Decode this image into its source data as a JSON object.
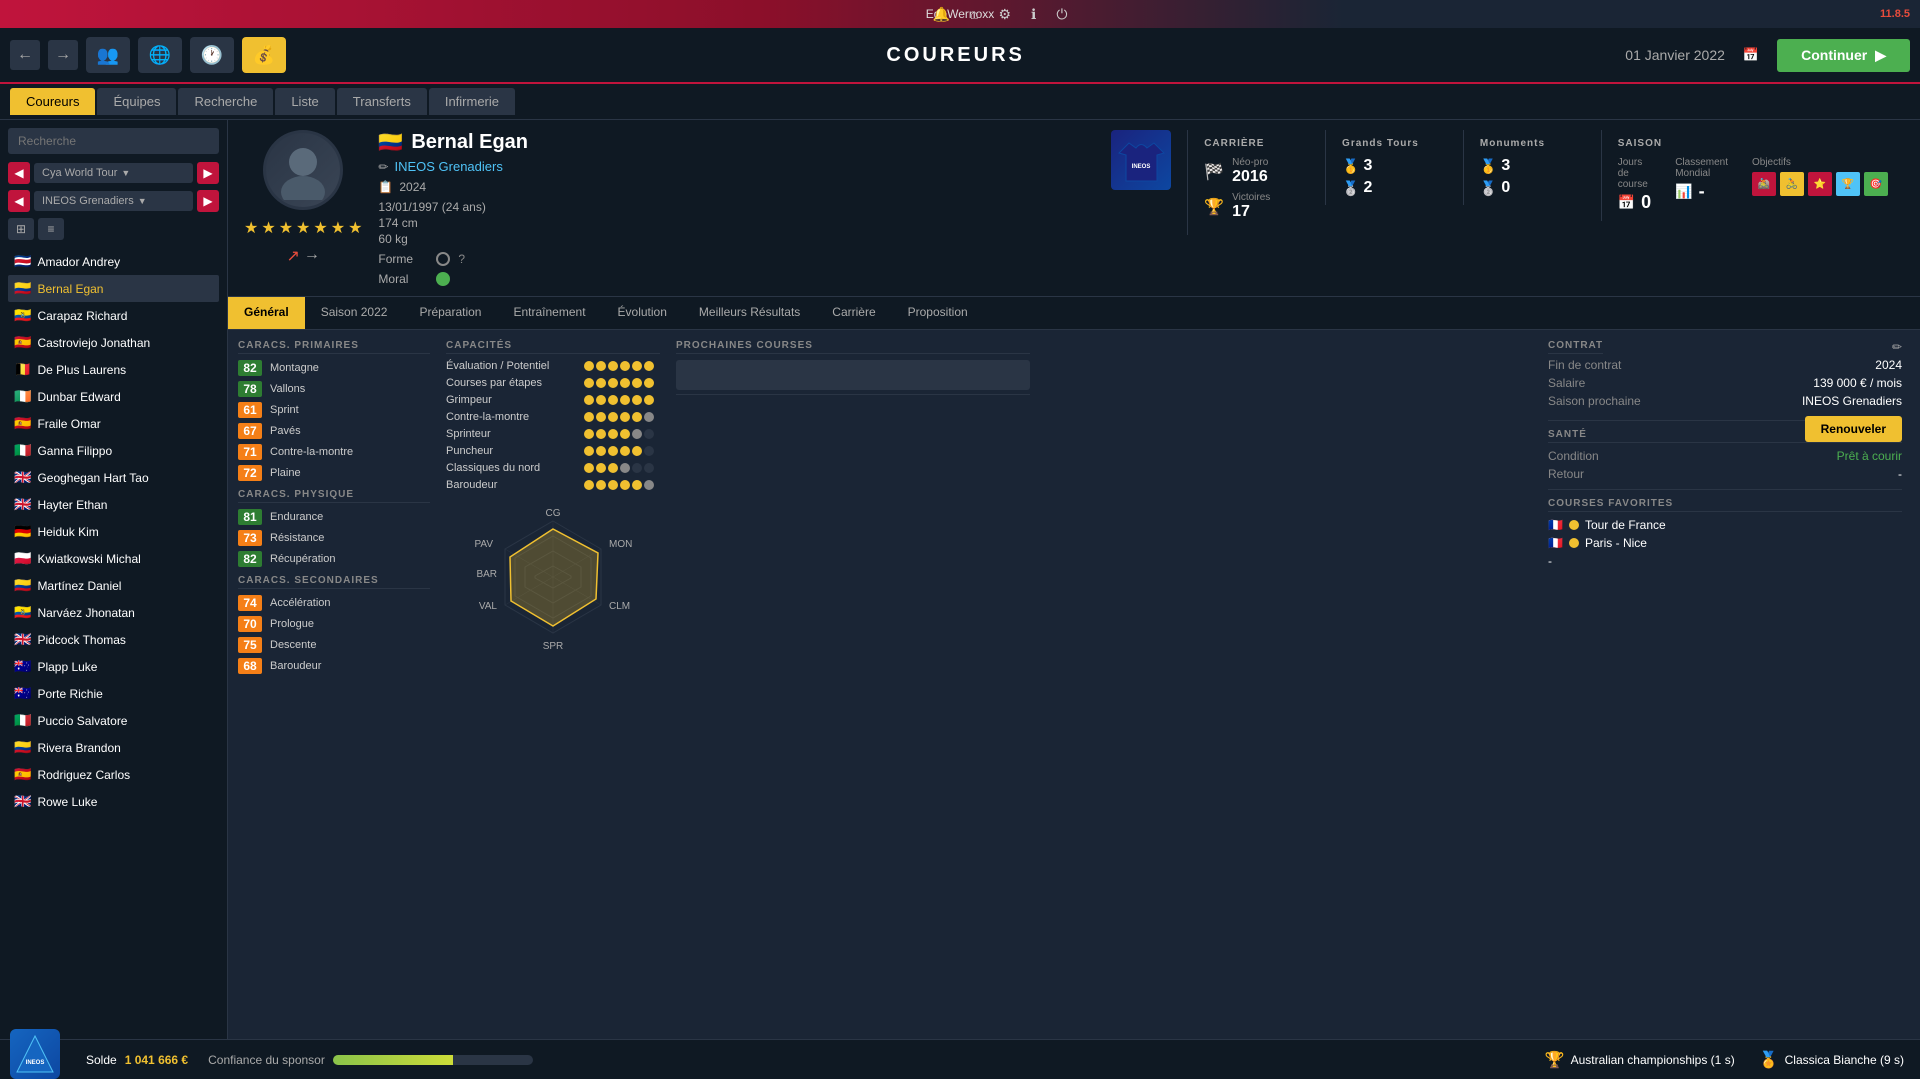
{
  "app": {
    "title": "EgoWernoxx",
    "page_title": "COUREURS",
    "date": "01 Janvier 2022",
    "continue_label": "Continuer",
    "version": "11.8.5"
  },
  "nav_icons": [
    "bell",
    "home",
    "gear",
    "info",
    "power"
  ],
  "nav_tabs": [
    "Coureurs",
    "Équipes",
    "Recherche",
    "Liste",
    "Transferts",
    "Infirmerie"
  ],
  "sidebar": {
    "search_placeholder": "Recherche",
    "filter1": "Cya World Tour",
    "filter2": "INEOS Grenadiers",
    "riders": [
      {
        "name": "Amador Andrey",
        "flag": "🇨🇷"
      },
      {
        "name": "Bernal Egan",
        "flag": "🇨🇴",
        "active": true
      },
      {
        "name": "Carapaz Richard",
        "flag": "🇪🇨"
      },
      {
        "name": "Castroviejo Jonathan",
        "flag": "🇪🇸"
      },
      {
        "name": "De Plus Laurens",
        "flag": "🇧🇪"
      },
      {
        "name": "Dunbar Edward",
        "flag": "🇮🇪"
      },
      {
        "name": "Fraile Omar",
        "flag": "🇪🇸"
      },
      {
        "name": "Ganna Filippo",
        "flag": "🇮🇹"
      },
      {
        "name": "Geoghegan Hart Tao",
        "flag": "🇬🇧"
      },
      {
        "name": "Hayter Ethan",
        "flag": "🇬🇧"
      },
      {
        "name": "Heiduk Kim",
        "flag": "🇩🇪"
      },
      {
        "name": "Kwiatkowski Michal",
        "flag": "🇵🇱"
      },
      {
        "name": "Martínez Daniel",
        "flag": "🇨🇴"
      },
      {
        "name": "Narváez Jhonatan",
        "flag": "🇪🇨"
      },
      {
        "name": "Pidcock Thomas",
        "flag": "🇬🇧"
      },
      {
        "name": "Plapp Luke",
        "flag": "🇦🇺"
      },
      {
        "name": "Porte Richie",
        "flag": "🇦🇺"
      },
      {
        "name": "Puccio Salvatore",
        "flag": "🇮🇹"
      },
      {
        "name": "Rivera Brandon",
        "flag": "🇨🇴"
      },
      {
        "name": "Rodriguez Carlos",
        "flag": "🇪🇸"
      },
      {
        "name": "Rowe Luke",
        "flag": "🇬🇧"
      }
    ]
  },
  "rider": {
    "name": "Bernal Egan",
    "flag": "🇨🇴",
    "team": "INEOS Grenadiers",
    "year": "2024",
    "birthdate": "13/01/1997 (24 ans)",
    "height": "174 cm",
    "weight": "60 kg",
    "stars": 7,
    "forme_label": "Forme",
    "moral_label": "Moral",
    "career": {
      "title": "CARRIÈRE",
      "neo_pro_label": "Néo-pro",
      "neo_pro_year": "2016",
      "victoires_label": "Victoires",
      "victoires_value": "17",
      "grands_tours_label": "Grands Tours",
      "grands_tours_1": "3",
      "grands_tours_2": "2",
      "monuments_label": "Monuments",
      "monuments_1": "3",
      "monuments_2": "0"
    },
    "saison": {
      "title": "SAISON",
      "jours_label": "Jours de course",
      "jours_value": "0",
      "classement_label": "Classement Mondial",
      "classement_value": "-",
      "objectifs_label": "Objectifs"
    }
  },
  "profile_tabs": [
    "Général",
    "Saison 2022",
    "Préparation",
    "Entraînement",
    "Évolution",
    "Meilleurs Résultats",
    "Carrière",
    "Proposition"
  ],
  "active_tab": "Général",
  "caracs_primaires": {
    "title": "CARACS. PRIMAIRES",
    "items": [
      {
        "label": "Montagne",
        "value": 82,
        "color": "green"
      },
      {
        "label": "Vallons",
        "value": 78,
        "color": "green"
      },
      {
        "label": "Sprint",
        "value": 61,
        "color": "yellow"
      },
      {
        "label": "Pavés",
        "value": 67,
        "color": "yellow"
      },
      {
        "label": "Contre-la-montre",
        "value": 71,
        "color": "yellow"
      },
      {
        "label": "Plaine",
        "value": 72,
        "color": "yellow"
      }
    ]
  },
  "caracs_physique": {
    "title": "CARACS. PHYSIQUE",
    "items": [
      {
        "label": "Endurance",
        "value": 81,
        "color": "green"
      },
      {
        "label": "Résistance",
        "value": 73,
        "color": "yellow"
      },
      {
        "label": "Récupération",
        "value": 82,
        "color": "green"
      }
    ]
  },
  "caracs_secondaires": {
    "title": "CARACS. SECONDAIRES",
    "items": [
      {
        "label": "Accélération",
        "value": 74,
        "color": "yellow"
      },
      {
        "label": "Prologue",
        "value": 70,
        "color": "yellow"
      },
      {
        "label": "Descente",
        "value": 75,
        "color": "yellow"
      },
      {
        "label": "Baroudeur",
        "value": 68,
        "color": "yellow"
      }
    ]
  },
  "capacites": {
    "title": "CAPACITÉS",
    "items": [
      {
        "label": "Évaluation / Potentiel",
        "dots": 6,
        "filled": 6
      },
      {
        "label": "Courses par étapes",
        "dots": 6,
        "filled": 6
      },
      {
        "label": "Grimpeur",
        "dots": 6,
        "filled": 6
      },
      {
        "label": "Contre-la-montre",
        "dots": 6,
        "filled": 5,
        "partial": 1
      },
      {
        "label": "Sprinteur",
        "dots": 6,
        "filled": 4,
        "partial": 1
      },
      {
        "label": "Puncheur",
        "dots": 6,
        "filled": 5
      },
      {
        "label": "Classiques du nord",
        "dots": 6,
        "filled": 3,
        "partial": 1
      },
      {
        "label": "Baroudeur",
        "dots": 6,
        "filled": 5,
        "partial": 1
      }
    ]
  },
  "radar": {
    "labels": [
      "CG",
      "MON",
      "CLM",
      "SPR",
      "VAL",
      "PAV",
      "BAR"
    ],
    "values": [
      75,
      82,
      71,
      61,
      78,
      67,
      65
    ]
  },
  "prochaines_courses": {
    "title": "PROCHAINES COURSES"
  },
  "contrat": {
    "title": "CONTRAT",
    "fin_label": "Fin de contrat",
    "fin_value": "2024",
    "salaire_label": "Salaire",
    "salaire_value": "139 000 € / mois",
    "saison_label": "Saison prochaine",
    "saison_value": "INEOS Grenadiers",
    "renew_label": "Renouveler"
  },
  "sante": {
    "title": "SANTÉ",
    "condition_label": "Condition",
    "condition_value": "Prêt à courir",
    "retour_label": "Retour",
    "retour_value": "-"
  },
  "courses_favorites": {
    "title": "COURSES FAVORITES",
    "items": [
      {
        "name": "Tour de France",
        "flag": "🇫🇷"
      },
      {
        "name": "Paris - Nice",
        "flag": "🇫🇷"
      },
      {
        "name": "-"
      }
    ]
  },
  "bottom": {
    "solde_label": "Solde",
    "solde_value": "1 041 666 €",
    "sponsor_label": "Confiance du sponsor",
    "achievements": [
      {
        "icon": "🏆",
        "text": "Australian championships (1 s)"
      },
      {
        "icon": "🏅",
        "text": "Classica Bianche (9 s)"
      }
    ]
  }
}
